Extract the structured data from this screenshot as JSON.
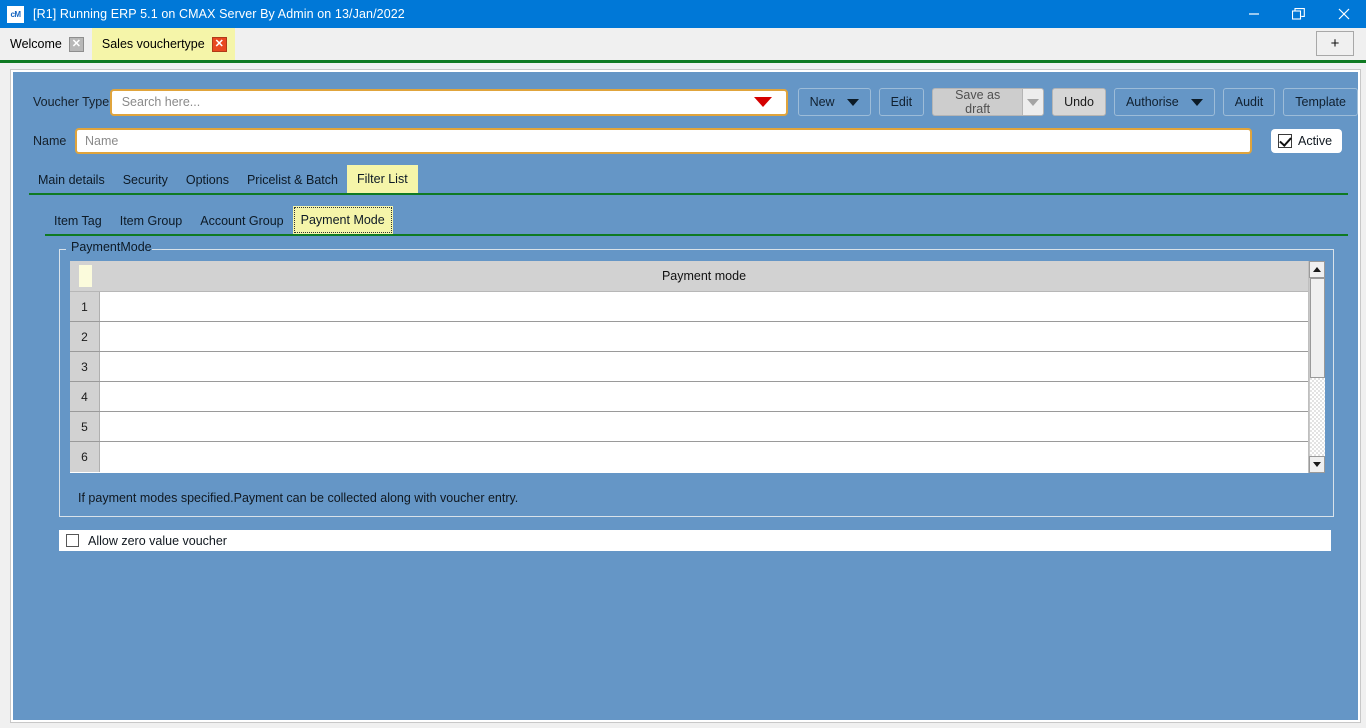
{
  "window": {
    "title": "[R1] Running ERP 5.1 on CMAX Server By Admin on 13/Jan/2022",
    "icon": "app-icon",
    "app_icon_text": "cM",
    "controls": {
      "minimize": "minimize-icon",
      "restore": "restore-icon",
      "close": "close-icon"
    },
    "accent_color": "#0078d7"
  },
  "tabstrip": {
    "tabs": [
      {
        "label": "Welcome",
        "active": false,
        "close_icon": "close-icon"
      },
      {
        "label": "Sales vouchertype",
        "active": true,
        "close_icon": "close-icon"
      }
    ],
    "new_tab_label": "+",
    "active_tab_color": "#f5f5a9"
  },
  "form": {
    "voucher_type": {
      "label": "Voucher Type",
      "value": "",
      "placeholder": "Search here...",
      "dropdown_icon": "chevron-down-icon",
      "dropdown_color": "#d40000",
      "border_color": "#e0a43c"
    },
    "name": {
      "label": "Name",
      "value": "",
      "placeholder": "Name"
    },
    "active": {
      "label": "Active",
      "checked": true
    }
  },
  "toolbar": {
    "new_label": "New",
    "edit_label": "Edit",
    "save_as_draft_label": "Save as draft",
    "undo_label": "Undo",
    "authorise_label": "Authorise",
    "audit_label": "Audit",
    "template_label": "Template"
  },
  "main_tabs": [
    {
      "label": "Main details",
      "active": false
    },
    {
      "label": "Security",
      "active": false
    },
    {
      "label": "Options",
      "active": false
    },
    {
      "label": "Pricelist & Batch",
      "active": false
    },
    {
      "label": "Filter List",
      "active": true
    }
  ],
  "sub_tabs": [
    {
      "label": "Item Tag",
      "active": false
    },
    {
      "label": "Item Group",
      "active": false
    },
    {
      "label": "Account Group",
      "active": false
    },
    {
      "label": "Payment Mode",
      "active": true
    }
  ],
  "payment_mode_group": {
    "legend": "PaymentMode",
    "grid": {
      "column_header": "Payment mode",
      "rows": [
        {
          "num": "1",
          "payment_mode": ""
        },
        {
          "num": "2",
          "payment_mode": ""
        },
        {
          "num": "3",
          "payment_mode": ""
        },
        {
          "num": "4",
          "payment_mode": ""
        },
        {
          "num": "5",
          "payment_mode": ""
        },
        {
          "num": "6",
          "payment_mode": ""
        }
      ]
    },
    "hint": "If payment modes specified.Payment can be collected along with voucher entry."
  },
  "zero_value": {
    "label": "Allow zero value voucher",
    "checked": false
  },
  "theme": {
    "panel_background": "#6596c6",
    "rule_green": "#0f7a22",
    "highlight_yellow": "#f5f5a9"
  }
}
